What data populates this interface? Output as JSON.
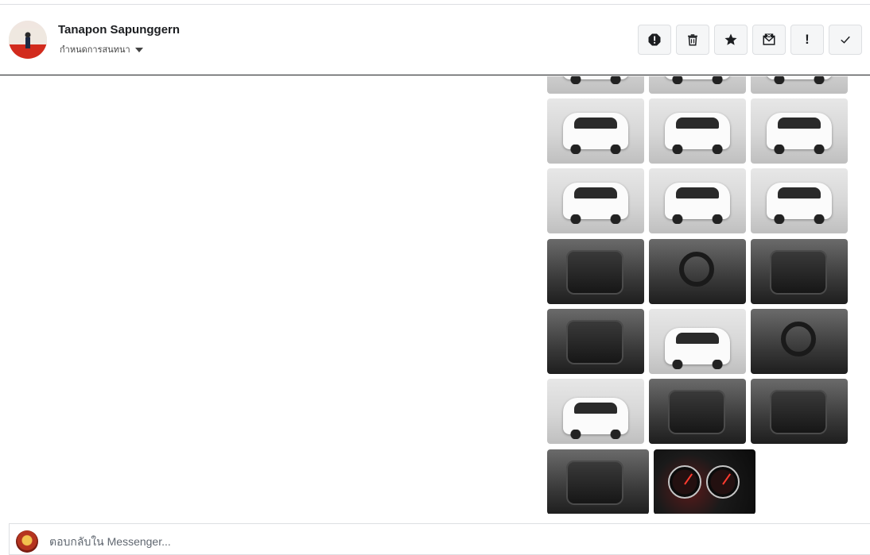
{
  "header": {
    "contact_name": "Tanapon Sapunggern",
    "assign_label": "กำหนดการสนทนา",
    "actions": [
      {
        "name": "spam-button",
        "icon": "alert-octagon-icon"
      },
      {
        "name": "delete-button",
        "icon": "trash-icon"
      },
      {
        "name": "star-button",
        "icon": "star-icon"
      },
      {
        "name": "mark-unread-button",
        "icon": "envelope-x-icon"
      },
      {
        "name": "follow-up-button",
        "icon": "exclamation-icon",
        "glyph": "!"
      },
      {
        "name": "mark-done-button",
        "icon": "check-icon"
      }
    ]
  },
  "gallery": {
    "photos": [
      {
        "label": "car-front-left-partial",
        "kind": "light"
      },
      {
        "label": "car-side-partial",
        "kind": "light"
      },
      {
        "label": "car-front-right-partial",
        "kind": "light"
      },
      {
        "label": "car-front-left",
        "kind": "light"
      },
      {
        "label": "car-side",
        "kind": "light"
      },
      {
        "label": "car-front-wheel",
        "kind": "light"
      },
      {
        "label": "car-front-angle",
        "kind": "light"
      },
      {
        "label": "car-rear-left",
        "kind": "light"
      },
      {
        "label": "car-rear",
        "kind": "light"
      },
      {
        "label": "door-panel",
        "kind": "dark"
      },
      {
        "label": "steering-dashboard",
        "kind": "dark"
      },
      {
        "label": "front-seats",
        "kind": "dark"
      },
      {
        "label": "driver-seat",
        "kind": "dark"
      },
      {
        "label": "open-trunk",
        "kind": "light"
      },
      {
        "label": "interior-overview",
        "kind": "dark"
      },
      {
        "label": "engine-bay",
        "kind": "light"
      },
      {
        "label": "second-row-seats",
        "kind": "dark"
      },
      {
        "label": "third-row-seats",
        "kind": "dark"
      },
      {
        "label": "rear-bench",
        "kind": "dark"
      },
      {
        "label": "instrument-cluster",
        "kind": "gauge"
      }
    ]
  },
  "composer": {
    "placeholder": "ตอบกลับใน Messenger..."
  },
  "colors": {
    "border": "#dddfe2",
    "button_bg": "#f5f6f7",
    "text": "#1c1e21"
  }
}
